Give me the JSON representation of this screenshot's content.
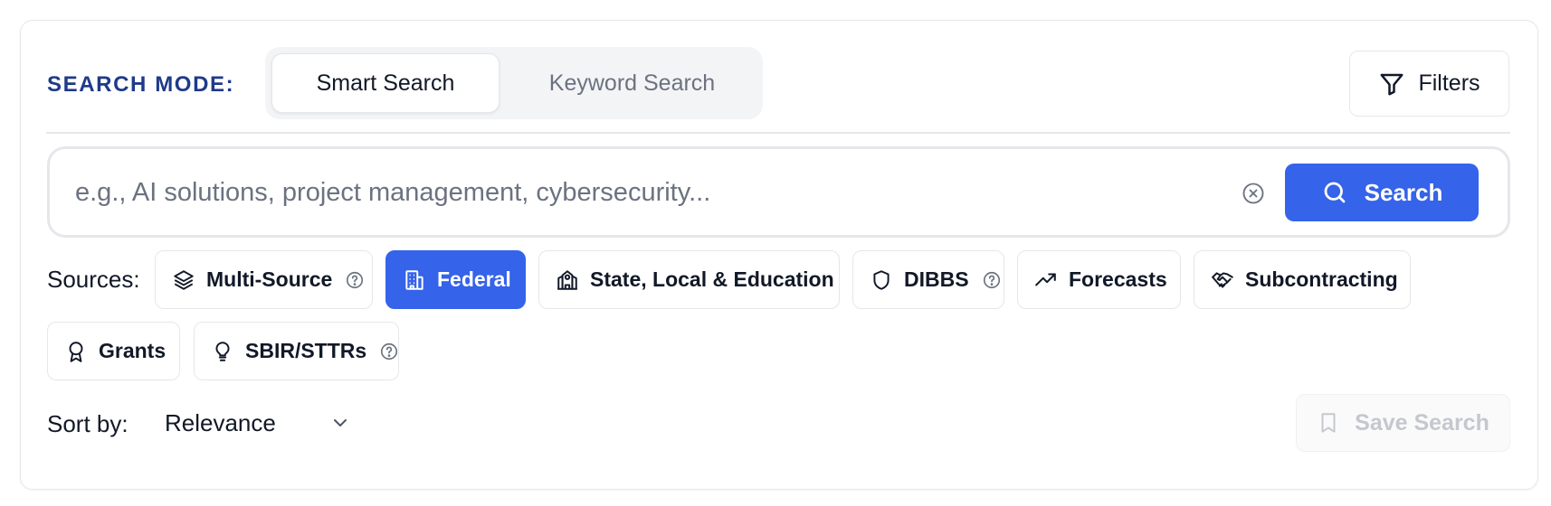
{
  "search_mode": {
    "label": "SEARCH MODE:",
    "options": [
      {
        "label": "Smart Search",
        "active": true
      },
      {
        "label": "Keyword Search",
        "active": false
      }
    ]
  },
  "filters": {
    "label": "Filters",
    "icon": "filter-icon"
  },
  "search": {
    "placeholder": "e.g., AI solutions, project management, cybersecurity...",
    "value": "",
    "button_label": "Search",
    "clear_icon": "circle-x-icon",
    "search_icon": "search-icon"
  },
  "sources": {
    "label": "Sources:",
    "items": [
      {
        "label": "Multi-Source",
        "icon": "layers-icon",
        "help": true,
        "active": false
      },
      {
        "label": "Federal",
        "icon": "building-icon",
        "help": false,
        "active": true
      },
      {
        "label": "State, Local & Education",
        "icon": "school-icon",
        "help": false,
        "active": false
      },
      {
        "label": "DIBBS",
        "icon": "shield-icon",
        "help": true,
        "active": false
      },
      {
        "label": "Forecasts",
        "icon": "trending-up-icon",
        "help": false,
        "active": false
      },
      {
        "label": "Subcontracting",
        "icon": "handshake-icon",
        "help": false,
        "active": false
      },
      {
        "label": "Grants",
        "icon": "award-icon",
        "help": false,
        "active": false
      },
      {
        "label": "SBIR/STTRs",
        "icon": "lightbulb-icon",
        "help": true,
        "active": false
      }
    ]
  },
  "sort": {
    "label": "Sort by:",
    "value": "Relevance"
  },
  "save_search": {
    "label": "Save Search",
    "disabled": true
  },
  "colors": {
    "accent": "#3563e9",
    "mode_label": "#1e3a8a",
    "border": "#e5e7eb"
  }
}
